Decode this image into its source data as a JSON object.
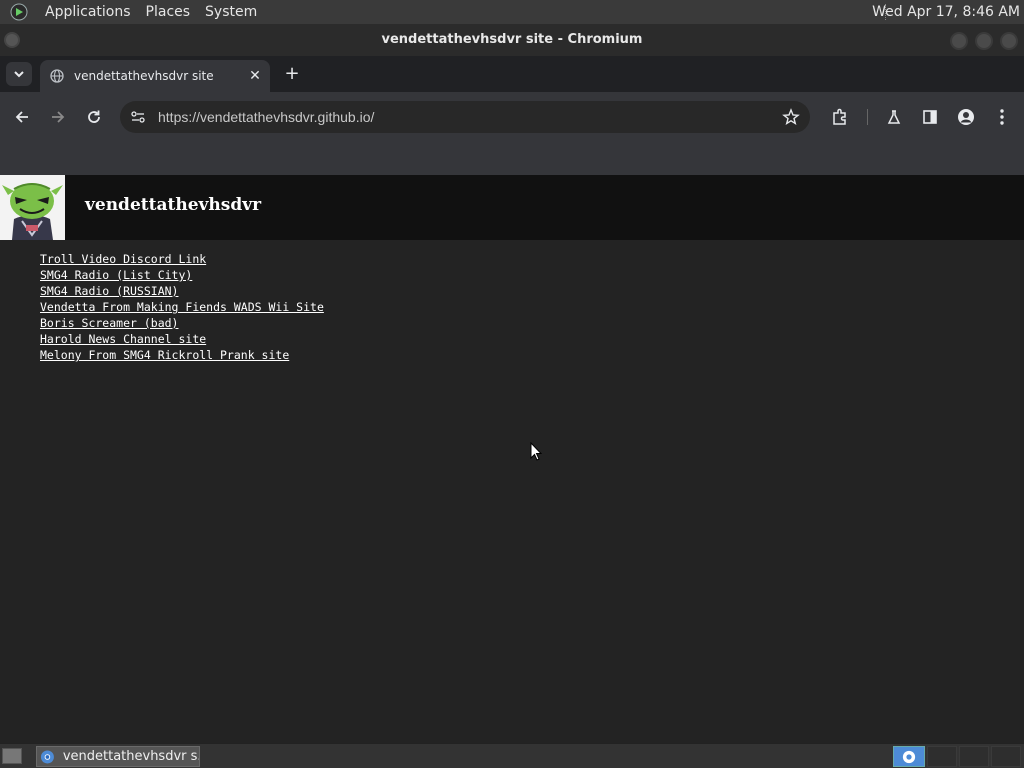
{
  "top_panel": {
    "menus": [
      "Applications",
      "Places",
      "System"
    ],
    "clock": "Wed Apr 17,  8:46 AM"
  },
  "window": {
    "title": "vendettathevhsdvr site - Chromium"
  },
  "browser": {
    "tab_title": "vendettathevhsdvr site",
    "url": "https://vendettathevhsdvr.github.io/"
  },
  "page": {
    "site_title": "vendettathevhsdvr",
    "links": [
      "Troll Video Discord Link",
      "SMG4 Radio (List City)",
      "SMG4 Radio (RUSSIAN)",
      "Vendetta From Making Fiends WADS Wii Site",
      "Boris Screamer (bad)",
      "Harold News Channel site",
      "Melony From SMG4 Rickroll Prank site"
    ]
  },
  "taskbar": {
    "task_label": "vendettathevhsdvr s..."
  }
}
